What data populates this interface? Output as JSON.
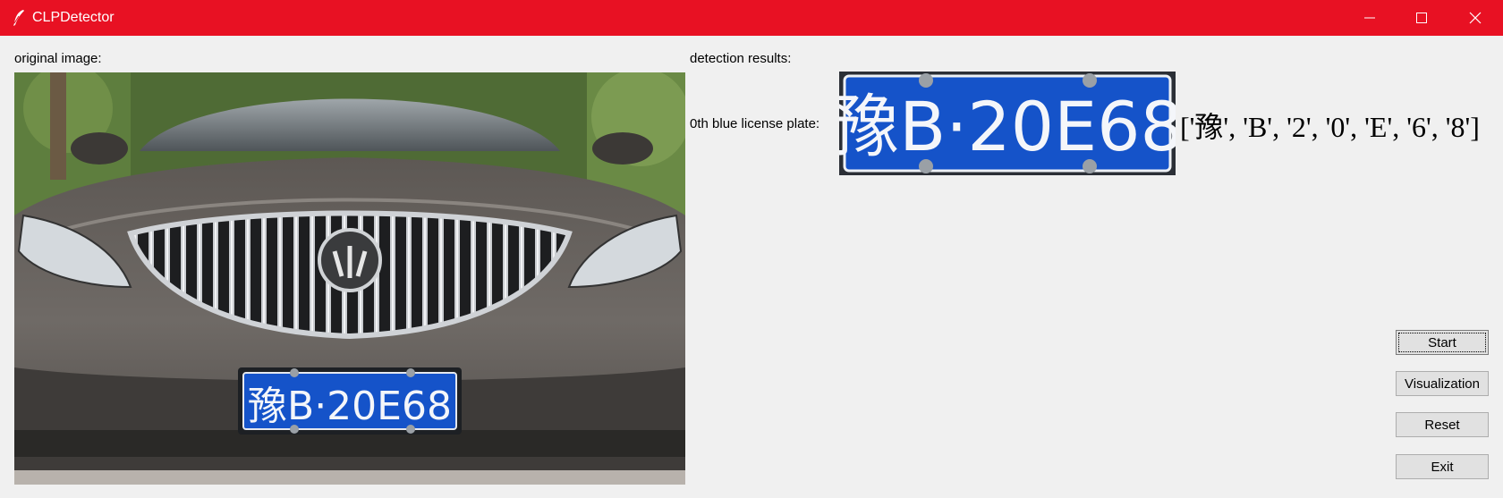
{
  "window": {
    "title": "CLPDetector",
    "icon": "feather-icon",
    "controls": [
      "minimize-icon",
      "maximize-icon",
      "close-icon"
    ],
    "titlebar_color": "#e81123"
  },
  "left_panel": {
    "label": "original image:"
  },
  "right_panel": {
    "label": "detection results:",
    "results": [
      {
        "label": "0th blue license plate:",
        "plate_text": "豫B·20E68",
        "chars_text": "['豫', 'B', '2', '0', 'E', '6', '8']"
      }
    ]
  },
  "photo": {
    "plate_text": "豫B·20E68"
  },
  "buttons": {
    "start": "Start",
    "visualization": "Visualization",
    "reset": "Reset",
    "exit": "Exit"
  },
  "colors": {
    "plate_blue": "#1553c9",
    "plate_text": "#f4f6fa"
  }
}
